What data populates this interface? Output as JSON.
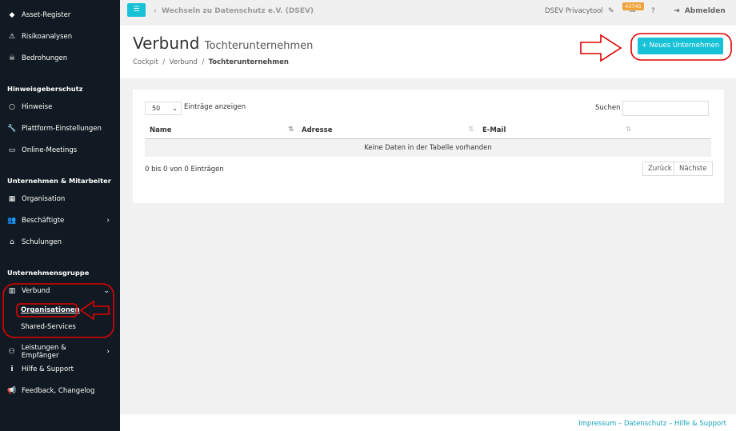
{
  "sidebar": {
    "items_top": [
      {
        "icon": "diamond-icon",
        "label": "Asset-Register"
      },
      {
        "icon": "warning-icon",
        "label": "Risikoanalysen"
      },
      {
        "icon": "threat-icon",
        "label": "Bedrohungen"
      }
    ],
    "section1": "Hinweisgeberschutz",
    "items1": [
      {
        "icon": "whistle-icon",
        "label": "Hinweise"
      },
      {
        "icon": "wrench-icon",
        "label": "Plattform-Einstellungen"
      },
      {
        "icon": "video-icon",
        "label": "Online-Meetings"
      }
    ],
    "section2": "Unternehmen & Mitarbeiter",
    "items2": [
      {
        "icon": "building-icon",
        "label": "Organisation"
      },
      {
        "icon": "users-icon",
        "label": "Beschäftigte"
      },
      {
        "icon": "school-icon",
        "label": "Schulungen"
      }
    ],
    "section3": "Unternehmensgruppe",
    "verbund": "Verbund",
    "sub": [
      "Organisationen",
      "Shared-Services"
    ],
    "items3": [
      {
        "icon": "people-icon",
        "label": "Leistungen & Empfänger"
      },
      {
        "icon": "info-icon",
        "label": "Hilfe & Support"
      },
      {
        "icon": "megaphone-icon",
        "label": "Feedback, Changelog"
      }
    ]
  },
  "topbar": {
    "switch": "Wechseln zu Datenschutz e.V. (DSEV)",
    "tool": "DSEV Privacytool",
    "badge": "43745",
    "logout": "Abmelden"
  },
  "header": {
    "title": "Verbund",
    "subtitle": "Tochterunternehmen",
    "breadcrumb": [
      "Cockpit",
      "Verbund",
      "Tochterunternehmen"
    ],
    "new_button": "+ Neues Unternehmen"
  },
  "table": {
    "length": "50",
    "length_label": "Einträge anzeigen",
    "search_label": "Suchen",
    "columns": [
      "Name",
      "Adresse",
      "E-Mail"
    ],
    "empty": "Keine Daten in der Tabelle vorhanden",
    "info": "0 bis 0 von 0 Einträgen",
    "prev": "Zurück",
    "next": "Nächste"
  },
  "footer": "Impressum – Datenschutz – Hilfe & Support",
  "colors": {
    "accent": "#17c1d6",
    "sidebar": "#111a22",
    "annotation": "#e00000"
  }
}
